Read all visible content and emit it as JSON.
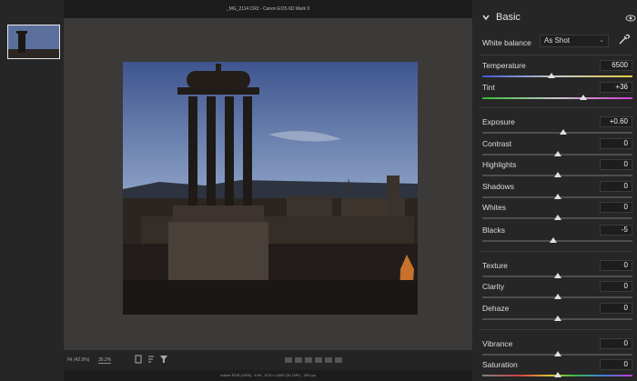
{
  "window": {
    "title": "_MG_2114.CR2  -  Canon EOS 6D Mark II"
  },
  "bottombar": {
    "fit_label": "Fit (42.9%)",
    "zoom_value": "35.2%"
  },
  "status_line": "Adobe RGB (1998) - 8 bit - 6720 x 4480 (30.1MP) - 300 ppi",
  "panel": {
    "title": "Basic",
    "white_balance": {
      "label": "White balance",
      "value": "As Shot"
    },
    "sliders": [
      {
        "label": "Temperature",
        "value": "6500",
        "pos": 0.46,
        "track": "temp"
      },
      {
        "label": "Tint",
        "value": "+36",
        "pos": 0.67,
        "track": "tint"
      },
      {
        "label": "Exposure",
        "value": "+0.60",
        "pos": 0.54,
        "track": "plain"
      },
      {
        "label": "Contrast",
        "value": "0",
        "pos": 0.5,
        "track": "plain"
      },
      {
        "label": "Highlights",
        "value": "0",
        "pos": 0.5,
        "track": "plain"
      },
      {
        "label": "Shadows",
        "value": "0",
        "pos": 0.5,
        "track": "plain"
      },
      {
        "label": "Whites",
        "value": "0",
        "pos": 0.5,
        "track": "plain"
      },
      {
        "label": "Blacks",
        "value": "-5",
        "pos": 0.475,
        "track": "plain"
      },
      {
        "label": "Texture",
        "value": "0",
        "pos": 0.5,
        "track": "plain"
      },
      {
        "label": "Clarity",
        "value": "0",
        "pos": 0.5,
        "track": "plain"
      },
      {
        "label": "Dehaze",
        "value": "0",
        "pos": 0.5,
        "track": "plain"
      },
      {
        "label": "Vibrance",
        "value": "0",
        "pos": 0.5,
        "track": "plain"
      },
      {
        "label": "Saturation",
        "value": "0",
        "pos": 0.5,
        "track": "sat"
      }
    ]
  }
}
